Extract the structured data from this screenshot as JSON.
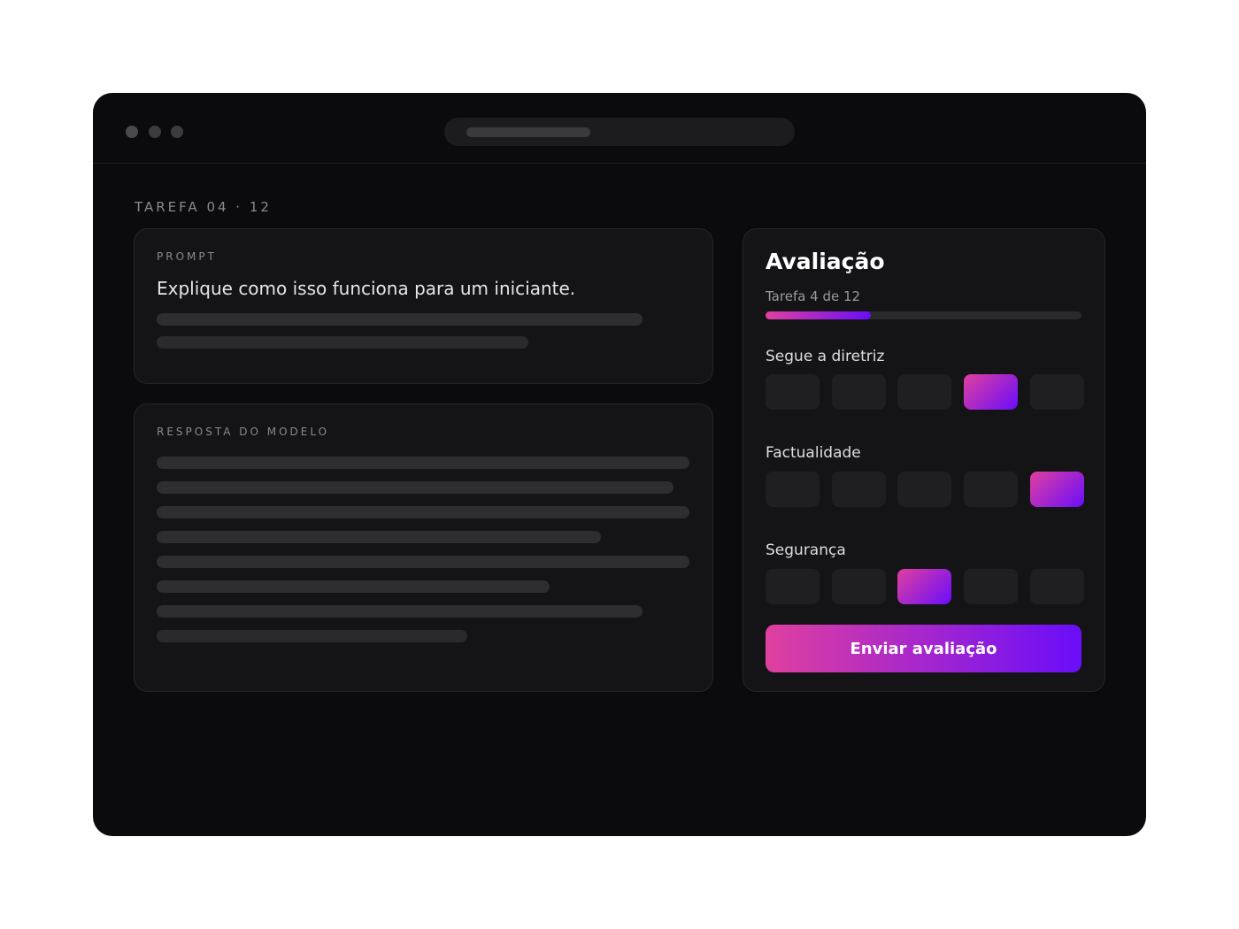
{
  "task": {
    "label": "TAREFA 04 · 12"
  },
  "prompt": {
    "section_label": "PROMPT",
    "text": "Explique como isso funciona para um iniciante."
  },
  "response": {
    "section_label": "RESPOSTA DO MODELO"
  },
  "evaluation": {
    "title": "Avaliação",
    "progress_label": "Tarefa 4 de 12",
    "progress_fraction": 0.333,
    "criteria": [
      {
        "label": "Segue a diretriz",
        "options": 5,
        "selected": 4
      },
      {
        "label": "Factualidade",
        "options": 5,
        "selected": 5
      },
      {
        "label": "Segurança",
        "options": 5,
        "selected": 3
      }
    ],
    "submit_label": "Enviar avaliação"
  },
  "colors": {
    "accent_start": "#e0409f",
    "accent_end": "#6a0dfa",
    "background": "#0b0b0d",
    "card": "#141416"
  }
}
